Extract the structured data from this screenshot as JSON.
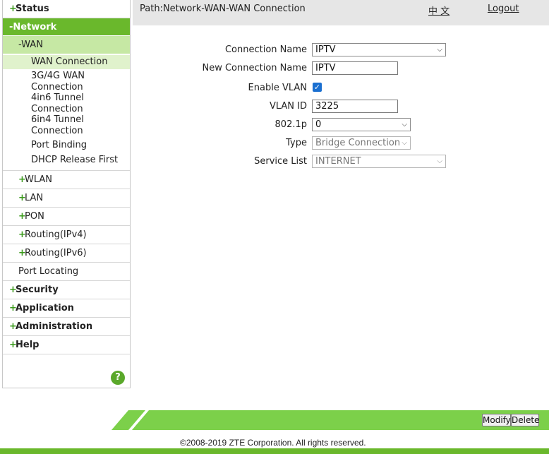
{
  "sidebar": {
    "status": "Status",
    "network": "-Network",
    "wan": "-WAN",
    "wan_items": [
      "WAN Connection",
      "3G/4G WAN",
      "Connection",
      "4in6 Tunnel",
      "Connection",
      "6in4 Tunnel",
      "Connection",
      "Port Binding",
      "DHCP Release First"
    ],
    "wlan": "WLAN",
    "lan": "LAN",
    "pon": "PON",
    "routing_ipv4": "Routing(IPv4)",
    "routing_ipv6": "Routing(IPv6)",
    "port_locating": "Port Locating",
    "security": "Security",
    "application": "Application",
    "administration": "Administration",
    "help": "Help",
    "help_icon": "?"
  },
  "header": {
    "path": "Path:Network-WAN-WAN Connection",
    "language": "中 文",
    "logout": "Logout"
  },
  "form": {
    "connection_name": {
      "label": "Connection Name",
      "value": "IPTV"
    },
    "new_connection_name": {
      "label": "New Connection Name",
      "value": "IPTV"
    },
    "enable_vlan": {
      "label": "Enable VLAN",
      "checked": true
    },
    "vlan_id": {
      "label": "VLAN ID",
      "value": "3225"
    },
    "p8021": {
      "label": "802.1p",
      "value": "0"
    },
    "type": {
      "label": "Type",
      "value": "Bridge Connection"
    },
    "service_list": {
      "label": "Service List",
      "value": "INTERNET"
    }
  },
  "footer": {
    "modify": "Modify",
    "delete": "Delete",
    "copyright": "©2008-2019 ZTE Corporation. All rights reserved."
  },
  "colors": {
    "accent_green": "#6ab82c",
    "light_green": "#c6e8a4",
    "footer_green": "#7cd04a"
  },
  "icons": {
    "expand": "plus-icon",
    "dropdown": "chevron-down-icon",
    "checkbox": "check-icon",
    "help": "help-icon"
  }
}
